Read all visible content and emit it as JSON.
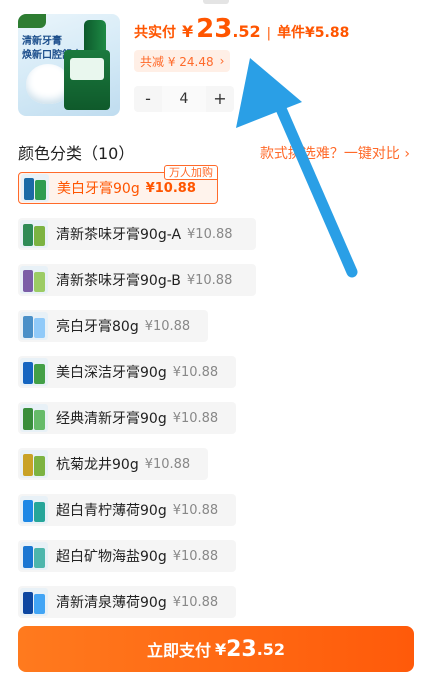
{
  "header": {
    "total_label": "共实付",
    "currency": "¥",
    "total_int": "23",
    "total_dec": ".52",
    "separator": "|",
    "unit_price": "单件¥5.88",
    "discount_text": "共减 ¥ 24.48",
    "discount_chevron": "›"
  },
  "stepper": {
    "minus": "-",
    "quantity": "4",
    "plus": "+"
  },
  "thumbnail": {
    "slogan_line1": "清新牙膏",
    "slogan_line2": "焕新口腔舒爽"
  },
  "section": {
    "title": "颜色分类（10）",
    "compare_link": "款式挑选难？一键对比 ›"
  },
  "sku_items": [
    {
      "name": "美白牙膏90g",
      "price": "¥10.88",
      "selected": true,
      "badge": "万人加购",
      "colors": [
        "#1b6aa5",
        "#2e9d4f"
      ]
    },
    {
      "name": "清新茶味牙膏90g-A",
      "price": "¥10.88",
      "selected": false,
      "colors": [
        "#2e8b57",
        "#7cb342"
      ]
    },
    {
      "name": "清新茶味牙膏90g-B",
      "price": "¥10.88",
      "selected": false,
      "colors": [
        "#7b5ea7",
        "#9ccc65"
      ]
    },
    {
      "name": "亮白牙膏80g",
      "price": "¥10.88",
      "selected": false,
      "colors": [
        "#4a90c8",
        "#90caf9"
      ]
    },
    {
      "name": "美白深洁牙膏90g",
      "price": "¥10.88",
      "selected": false,
      "colors": [
        "#1565c0",
        "#43a047"
      ]
    },
    {
      "name": "经典清新牙膏90g",
      "price": "¥10.88",
      "selected": false,
      "colors": [
        "#388e3c",
        "#66bb6a"
      ]
    },
    {
      "name": "杭菊龙井90g",
      "price": "¥10.88",
      "selected": false,
      "colors": [
        "#c9a227",
        "#7cb342"
      ]
    },
    {
      "name": "超白青柠薄荷90g",
      "price": "¥10.88",
      "selected": false,
      "colors": [
        "#1e88e5",
        "#26a69a"
      ]
    },
    {
      "name": "超白矿物海盐90g",
      "price": "¥10.88",
      "selected": false,
      "colors": [
        "#1976d2",
        "#4db6ac"
      ]
    },
    {
      "name": "清新清泉薄荷90g",
      "price": "¥10.88",
      "selected": false,
      "colors": [
        "#0d47a1",
        "#42a5f5"
      ]
    }
  ],
  "pay_button": {
    "label": "立即支付",
    "currency": "¥",
    "amount_int": "23",
    "amount_dec": ".52"
  },
  "colors": {
    "accent": "#ff5500",
    "arrow": "#2a9fe6"
  }
}
